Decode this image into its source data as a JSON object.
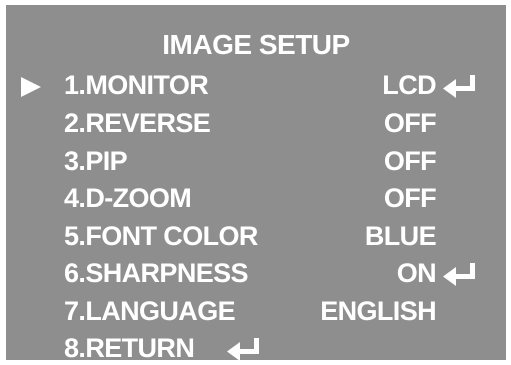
{
  "title": "IMAGE SETUP",
  "selected_index": 0,
  "selector_icon": "triangle-right",
  "enter_icon": "return-arrow",
  "menu": {
    "items": [
      {
        "label": "1.MONITOR",
        "value": "LCD",
        "submenu": true
      },
      {
        "label": "2.REVERSE",
        "value": "OFF",
        "submenu": false
      },
      {
        "label": "3.PIP",
        "value": "OFF",
        "submenu": false
      },
      {
        "label": "4.D-ZOOM",
        "value": "OFF",
        "submenu": false
      },
      {
        "label": "5.FONT COLOR",
        "value": "BLUE",
        "submenu": false
      },
      {
        "label": "6.SHARPNESS",
        "value": "ON",
        "submenu": true
      },
      {
        "label": "7.LANGUAGE",
        "value": "ENGLISH",
        "submenu": false
      },
      {
        "label": "8.RETURN",
        "value": "",
        "submenu": true
      }
    ]
  },
  "colors": {
    "background": "#8e8e8e",
    "text": "#ffffff"
  }
}
